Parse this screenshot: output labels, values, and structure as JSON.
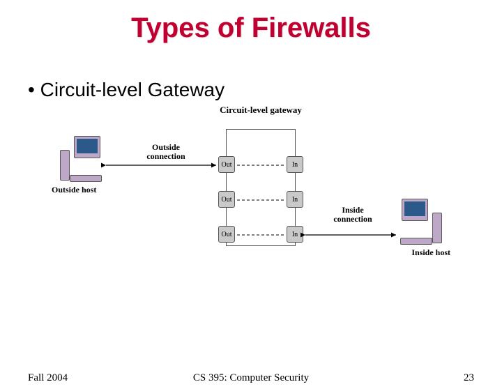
{
  "title": "Types of Firewalls",
  "bullet_text": "Circuit-level Gateway",
  "footer": {
    "term": "Fall 2004",
    "course": "CS 395: Computer Security",
    "page": "23"
  },
  "diagram": {
    "gateway_label": "Circuit-level gateway",
    "ports": {
      "out": "Out",
      "in": "In"
    },
    "outside_host": "Outside host",
    "inside_host": "Inside host",
    "outside_connection": "Outside connection",
    "inside_connection": "Inside connection"
  }
}
